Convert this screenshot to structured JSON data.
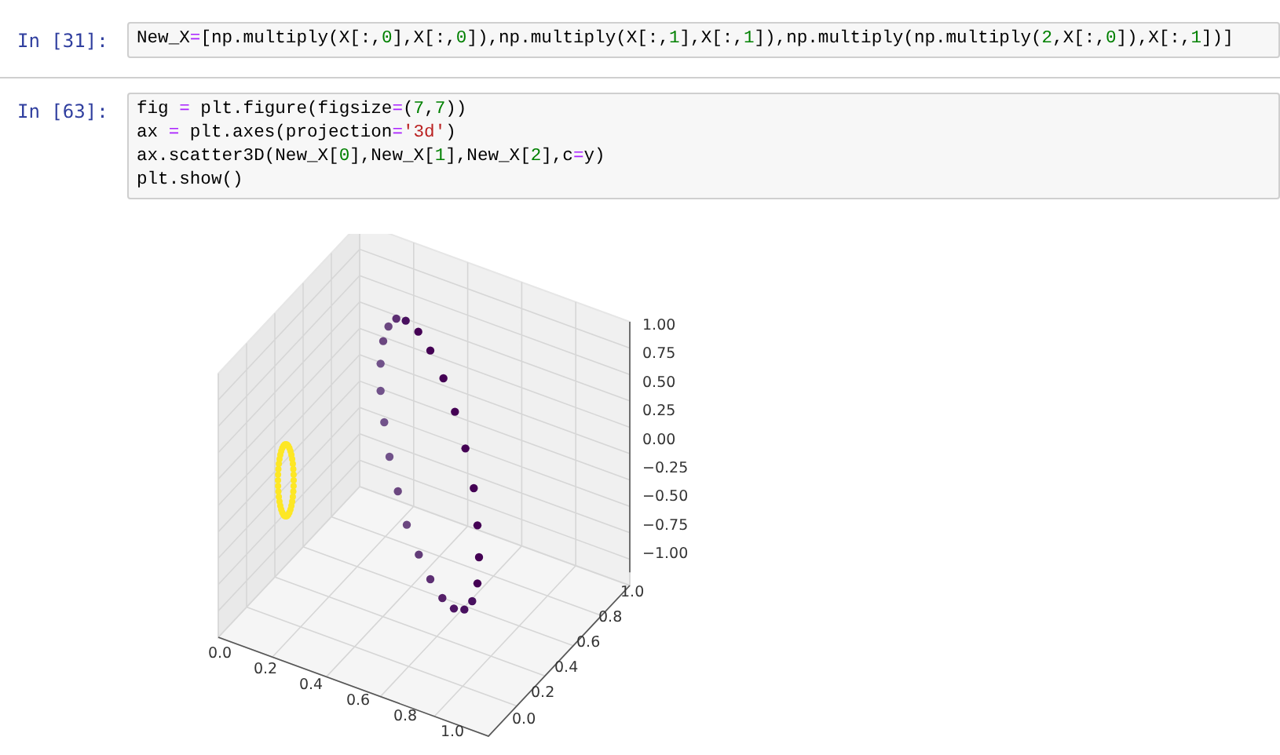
{
  "cells": [
    {
      "prompt": "In [31]:",
      "lines": [
        [
          {
            "kind": "plain",
            "text": "New_X"
          },
          {
            "kind": "op",
            "text": "="
          },
          {
            "kind": "plain",
            "text": "[np.multiply(X[:,"
          },
          {
            "kind": "num",
            "text": "0"
          },
          {
            "kind": "plain",
            "text": "],X[:,"
          },
          {
            "kind": "num",
            "text": "0"
          },
          {
            "kind": "plain",
            "text": "]),np.multiply(X[:,"
          },
          {
            "kind": "num",
            "text": "1"
          },
          {
            "kind": "plain",
            "text": "],X[:,"
          },
          {
            "kind": "num",
            "text": "1"
          },
          {
            "kind": "plain",
            "text": "]),np.multiply(np.multiply("
          },
          {
            "kind": "num",
            "text": "2"
          },
          {
            "kind": "plain",
            "text": ",X[:,"
          },
          {
            "kind": "num",
            "text": "0"
          },
          {
            "kind": "plain",
            "text": "]),X[:,"
          },
          {
            "kind": "num",
            "text": "1"
          },
          {
            "kind": "plain",
            "text": "])]"
          }
        ]
      ]
    },
    {
      "prompt": "In [63]:",
      "lines": [
        [
          {
            "kind": "plain",
            "text": "fig "
          },
          {
            "kind": "op",
            "text": "="
          },
          {
            "kind": "plain",
            "text": " plt.figure(figsize"
          },
          {
            "kind": "op",
            "text": "="
          },
          {
            "kind": "plain",
            "text": "("
          },
          {
            "kind": "num",
            "text": "7"
          },
          {
            "kind": "plain",
            "text": ","
          },
          {
            "kind": "num",
            "text": "7"
          },
          {
            "kind": "plain",
            "text": "))"
          }
        ],
        [
          {
            "kind": "plain",
            "text": "ax "
          },
          {
            "kind": "op",
            "text": "="
          },
          {
            "kind": "plain",
            "text": " plt.axes(projection"
          },
          {
            "kind": "op",
            "text": "="
          },
          {
            "kind": "str",
            "text": "'3d'"
          },
          {
            "kind": "plain",
            "text": ")"
          }
        ],
        [
          {
            "kind": "plain",
            "text": "ax.scatter3D(New_X["
          },
          {
            "kind": "num",
            "text": "0"
          },
          {
            "kind": "plain",
            "text": "],New_X["
          },
          {
            "kind": "num",
            "text": "1"
          },
          {
            "kind": "plain",
            "text": "],New_X["
          },
          {
            "kind": "num",
            "text": "2"
          },
          {
            "kind": "plain",
            "text": "],c"
          },
          {
            "kind": "op",
            "text": "="
          },
          {
            "kind": "plain",
            "text": "y)"
          }
        ],
        [
          {
            "kind": "plain",
            "text": "plt.show()"
          }
        ]
      ],
      "output": {
        "plot": {
          "x_ticks": [
            "0.0",
            "0.2",
            "0.4",
            "0.6",
            "0.8",
            "1.0"
          ],
          "y_ticks": [
            "0.0",
            "0.2",
            "0.4",
            "0.6",
            "0.8",
            "1.0"
          ],
          "z_ticks": [
            "1.00",
            "0.75",
            "0.50",
            "0.25",
            "0.00",
            "−0.25",
            "−0.50",
            "−0.75",
            "−1.00"
          ]
        }
      }
    }
  ]
}
